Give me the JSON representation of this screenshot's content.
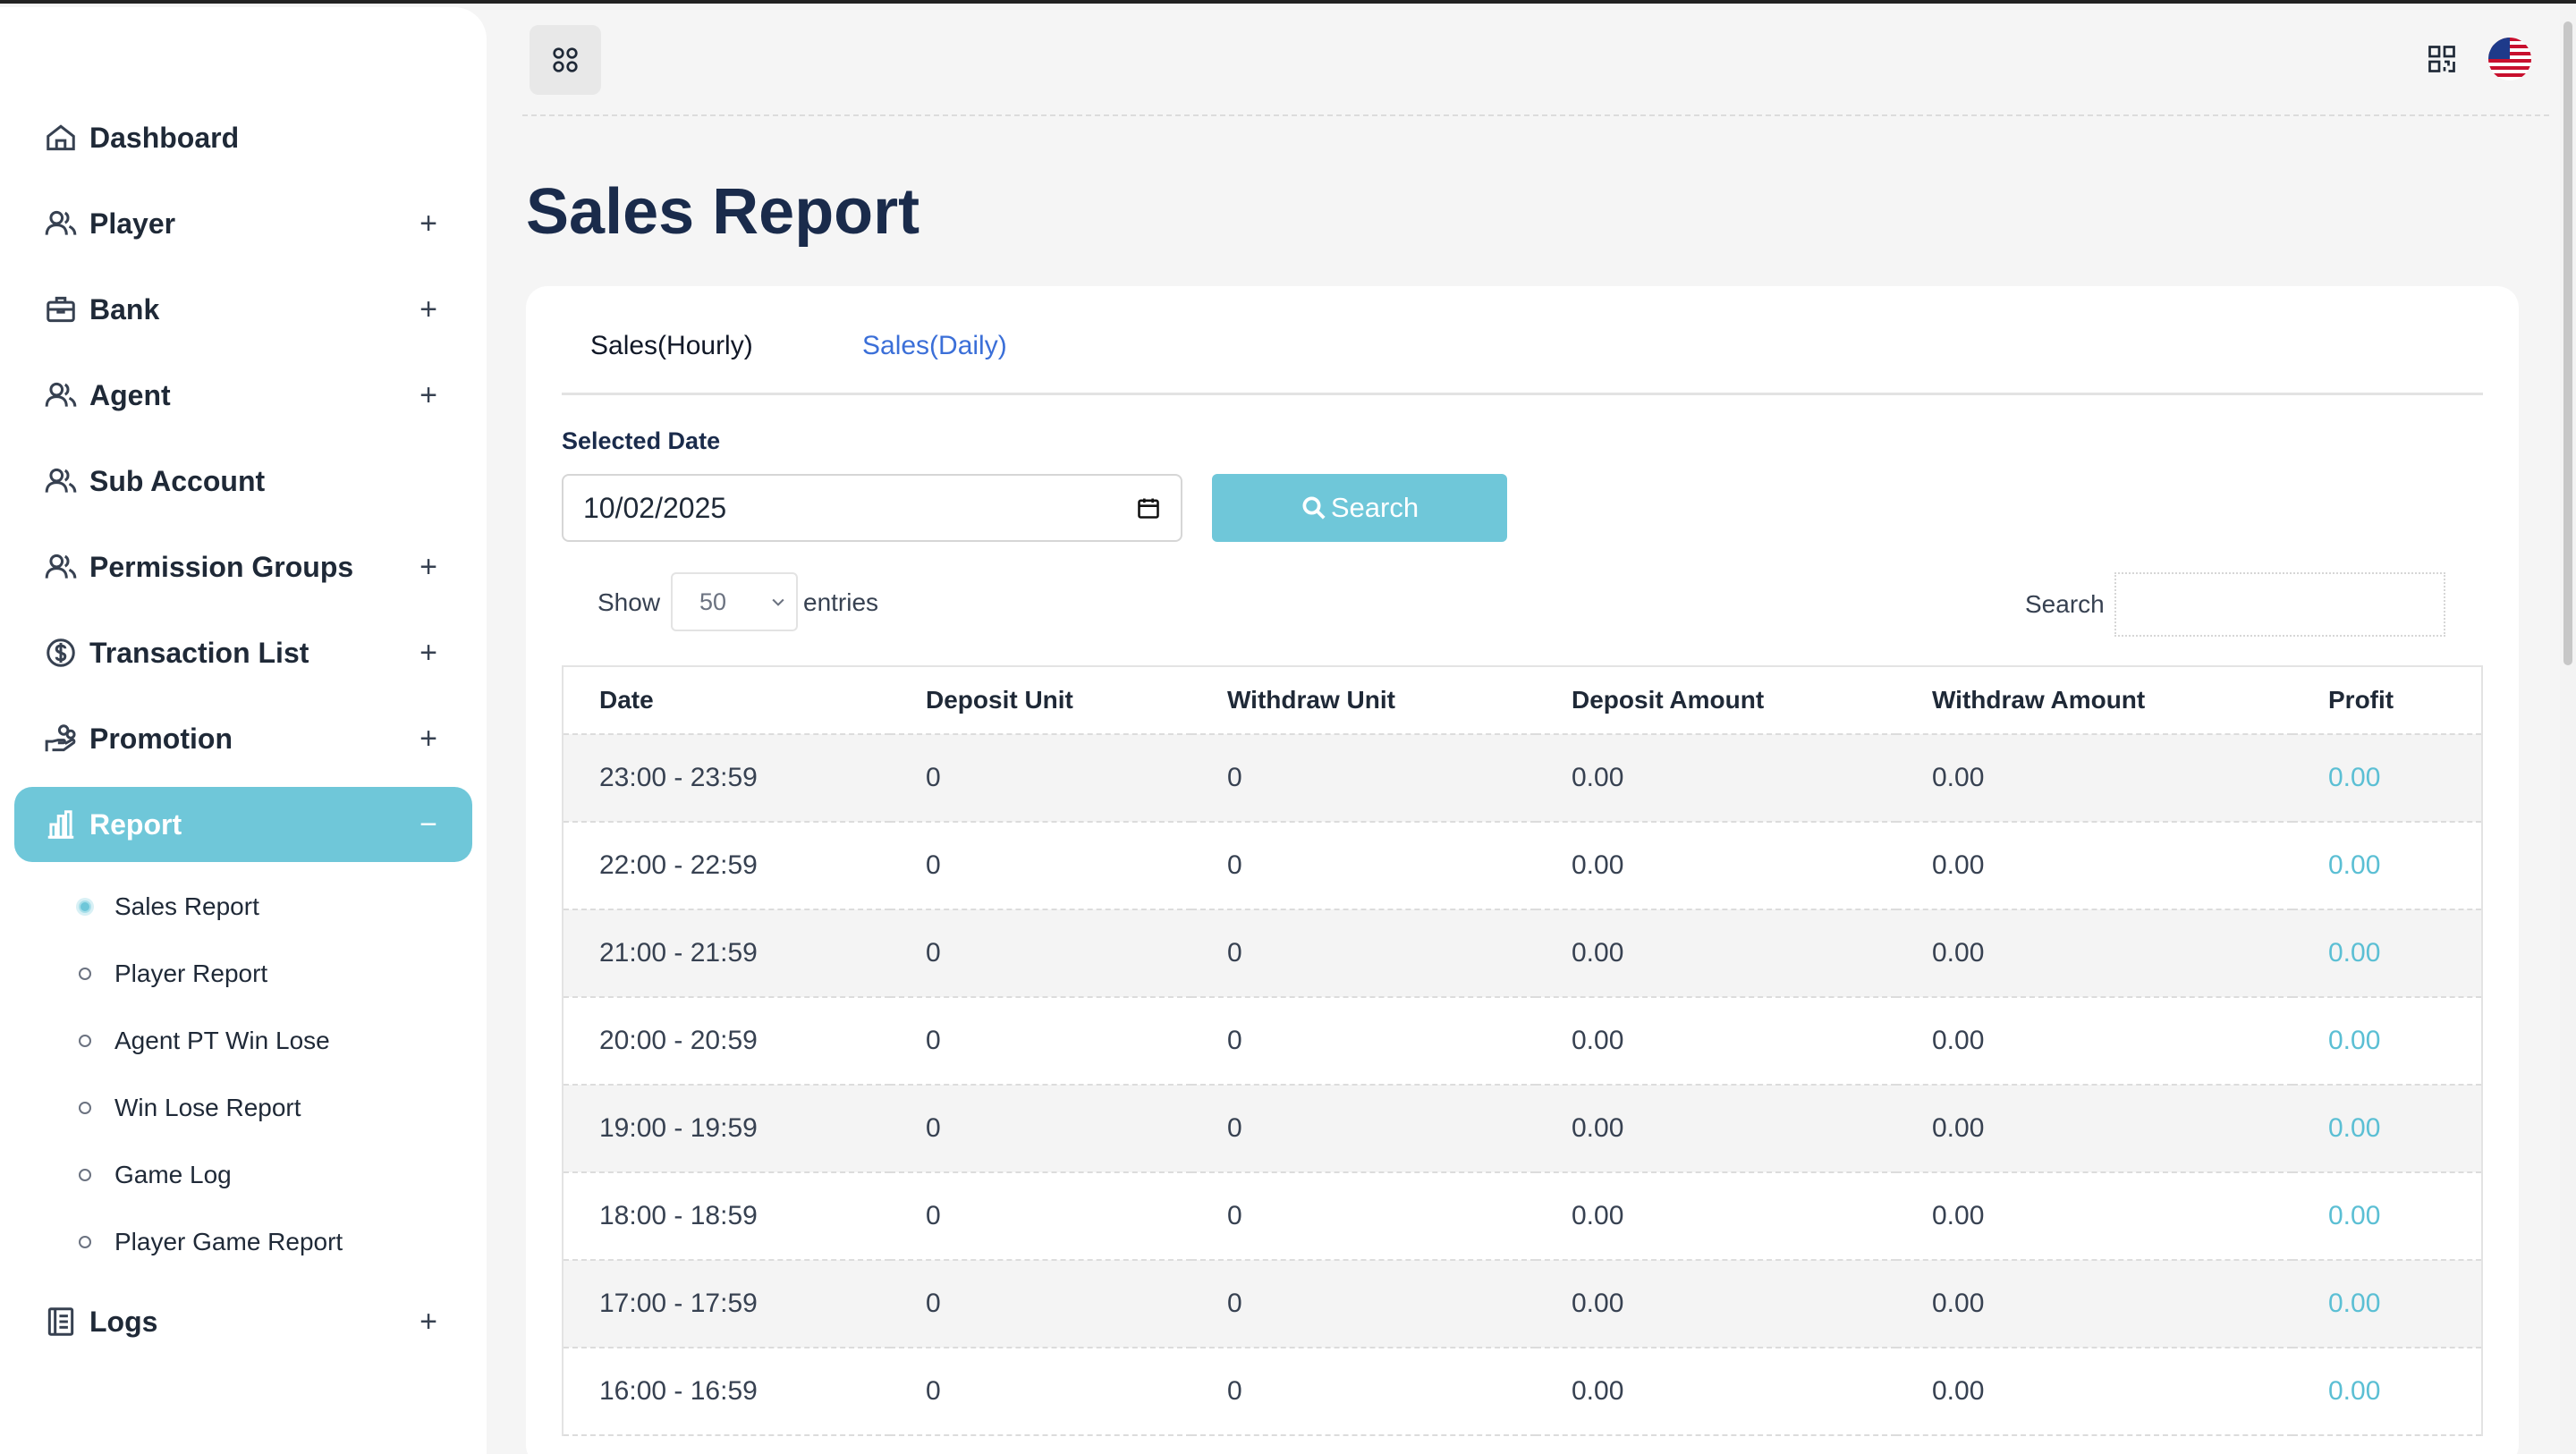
{
  "sidebar": {
    "items": [
      {
        "label": "Dashboard",
        "icon": "home-icon",
        "toggle": ""
      },
      {
        "label": "Player",
        "icon": "users-icon",
        "toggle": "+"
      },
      {
        "label": "Bank",
        "icon": "briefcase-icon",
        "toggle": "+"
      },
      {
        "label": "Agent",
        "icon": "users-icon",
        "toggle": "+"
      },
      {
        "label": "Sub Account",
        "icon": "users-icon",
        "toggle": ""
      },
      {
        "label": "Permission Groups",
        "icon": "users-icon",
        "toggle": "+"
      },
      {
        "label": "Transaction List",
        "icon": "dollar-circle-icon",
        "toggle": "+"
      },
      {
        "label": "Promotion",
        "icon": "hand-coins-icon",
        "toggle": "+"
      },
      {
        "label": "Report",
        "icon": "bar-chart-icon",
        "toggle": "−"
      }
    ],
    "report_sub": [
      {
        "label": "Sales Report"
      },
      {
        "label": "Player Report"
      },
      {
        "label": "Agent PT Win Lose"
      },
      {
        "label": "Win Lose Report"
      },
      {
        "label": "Game Log"
      },
      {
        "label": "Player Game Report"
      }
    ],
    "logs": {
      "label": "Logs",
      "toggle": "+"
    }
  },
  "page": {
    "title": "Sales Report"
  },
  "tabs": [
    {
      "label": "Sales(Hourly)"
    },
    {
      "label": "Sales(Daily)"
    }
  ],
  "form": {
    "date_label": "Selected Date",
    "date_value": "10/02/2025",
    "search_button": "Search"
  },
  "table_controls": {
    "show": "Show",
    "entries_value": "50",
    "entries": "entries",
    "search_label": "Search"
  },
  "table": {
    "headers": [
      "Date",
      "Deposit Unit",
      "Withdraw Unit",
      "Deposit Amount",
      "Withdraw Amount",
      "Profit"
    ],
    "rows": [
      [
        "23:00 - 23:59",
        "0",
        "0",
        "0.00",
        "0.00",
        "0.00"
      ],
      [
        "22:00 - 22:59",
        "0",
        "0",
        "0.00",
        "0.00",
        "0.00"
      ],
      [
        "21:00 - 21:59",
        "0",
        "0",
        "0.00",
        "0.00",
        "0.00"
      ],
      [
        "20:00 - 20:59",
        "0",
        "0",
        "0.00",
        "0.00",
        "0.00"
      ],
      [
        "19:00 - 19:59",
        "0",
        "0",
        "0.00",
        "0.00",
        "0.00"
      ],
      [
        "18:00 - 18:59",
        "0",
        "0",
        "0.00",
        "0.00",
        "0.00"
      ],
      [
        "17:00 - 17:59",
        "0",
        "0",
        "0.00",
        "0.00",
        "0.00"
      ],
      [
        "16:00 - 16:59",
        "0",
        "0",
        "0.00",
        "0.00",
        "0.00"
      ]
    ]
  },
  "colors": {
    "accent": "#6fc7d9",
    "title": "#1a2b4b",
    "link": "#3b6fd8",
    "profit": "#5bbfd4"
  }
}
